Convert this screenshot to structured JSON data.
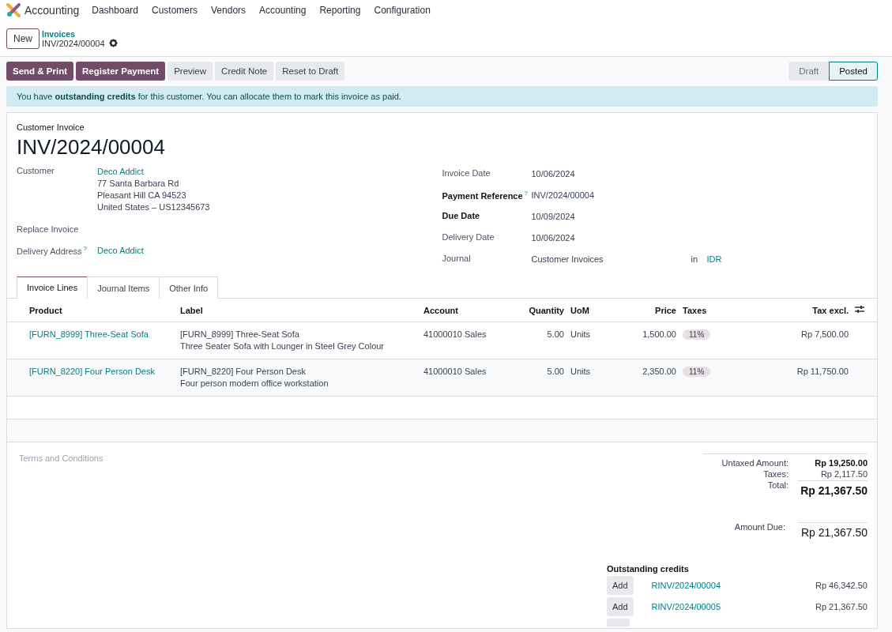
{
  "app": {
    "name": "Accounting"
  },
  "menu": [
    "Dashboard",
    "Customers",
    "Vendors",
    "Accounting",
    "Reporting",
    "Configuration"
  ],
  "breadcrumb": {
    "new_button": "New",
    "parent": "Invoices",
    "current": "INV/2024/00004"
  },
  "actions": [
    {
      "label": "Send & Print",
      "kind": "primary"
    },
    {
      "label": "Register Payment",
      "kind": "primary"
    },
    {
      "label": "Preview",
      "kind": "secondary"
    },
    {
      "label": "Credit Note",
      "kind": "secondary"
    },
    {
      "label": "Reset to Draft",
      "kind": "secondary"
    }
  ],
  "stages": [
    {
      "label": "Draft",
      "selected": false
    },
    {
      "label": "Posted",
      "selected": true
    }
  ],
  "alert": "You have **outstanding credits** for this customer. You can allocate them to mark this invoice as paid.",
  "form": {
    "type_label": "Customer Invoice",
    "number": "INV/2024/00004",
    "left_fields": [
      {
        "label": "Customer",
        "required": false,
        "value": "Deco Addict",
        "lines": [
          "77 Santa Barbara Rd",
          "Pleasant Hill CA 94523",
          "United States – US12345673"
        ]
      },
      {
        "label": "Replace Invoice",
        "required": false
      },
      {
        "label": "Delivery Address",
        "help": "?",
        "required": false,
        "value": "Deco Addict"
      }
    ],
    "right_fields": [
      {
        "label": "Invoice Date",
        "required": false,
        "value": "10/06/2024"
      },
      {
        "label": "Payment Reference",
        "help": "?",
        "required": true,
        "value": "INV/2024/00004"
      },
      {
        "label": "Due Date",
        "required": true,
        "value": "10/09/2024"
      },
      {
        "label": "Delivery Date",
        "required": false,
        "value": "10/06/2024"
      },
      {
        "label": "Journal",
        "required": false,
        "value": "Customer Invoices",
        "in": "in",
        "currency": "IDR"
      }
    ]
  },
  "tabs": [
    {
      "label": "Invoice Lines",
      "selected": true
    },
    {
      "label": "Journal Items",
      "selected": false
    },
    {
      "label": "Other Info",
      "selected": false
    }
  ],
  "table": {
    "columns": [
      "Product",
      "Label",
      "Account",
      "Quantity",
      "UoM",
      "Price",
      "Taxes",
      "Tax excl."
    ],
    "rows": [
      {
        "product": "[FURN_8999] Three-Seat Sofa",
        "label": [
          "[FURN_8999] Three-Seat Sofa",
          "Three Seater Sofa with Lounger in Steel Grey Colour"
        ],
        "account": "41000010 Sales",
        "quantity": "5.00",
        "uom": "Units",
        "price": "1,500.00",
        "taxes": "11%",
        "subtotal": "Rp 7,500.00"
      },
      {
        "product": "[FURN_8220] Four Person Desk",
        "label": [
          "[FURN_8220] Four Person Desk",
          "Four person modern office workstation"
        ],
        "account": "41000010 Sales",
        "quantity": "5.00",
        "uom": "Units",
        "price": "2,350.00",
        "taxes": "11%",
        "subtotal": "Rp 11,750.00"
      }
    ]
  },
  "terms_placeholder": "Terms and Conditions",
  "totals": {
    "untaxed_label": "Untaxed Amount:",
    "untaxed": "Rp 19,250.00",
    "taxes_label": "Taxes:",
    "taxes": "Rp 2,117.50",
    "total_label": "Total:",
    "total": "Rp 21,367.50",
    "due_label": "Amount Due:",
    "due": "Rp 21,367.50"
  },
  "outstanding": {
    "title": "Outstanding credits",
    "items": [
      {
        "button": "Add",
        "ref": "RINV/2024/00004",
        "amount": "Rp 46,342.50"
      },
      {
        "button": "Add",
        "ref": "RINV/2024/00005",
        "amount": "Rp 21,367.50"
      }
    ]
  }
}
